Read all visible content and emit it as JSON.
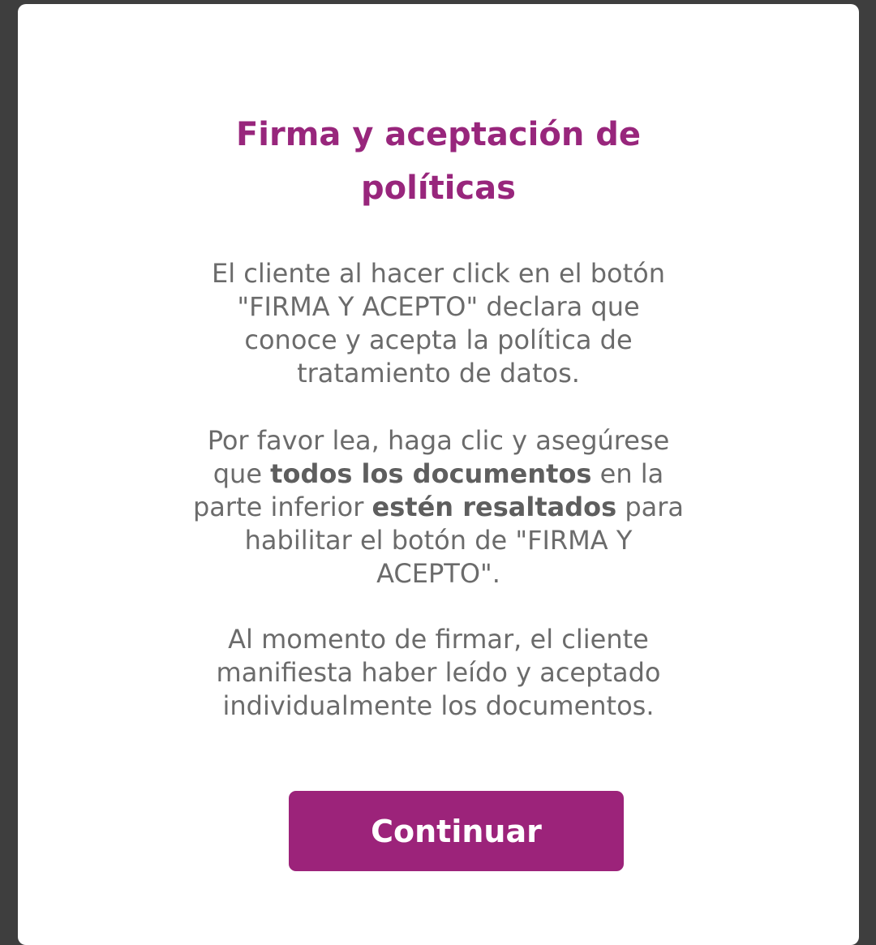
{
  "dialog": {
    "title_lines": [
      "Firma y aceptación de",
      "políticas"
    ],
    "paragraph1_lines": [
      "El cliente al hacer click en el botón",
      "\"FIRMA Y ACEPTO\" declara que",
      "conoce y acepta la política de",
      "tratamiento de datos."
    ],
    "paragraph2": {
      "line1": "Por favor lea, haga clic y asegúrese",
      "line2_pre": "que ",
      "line2_bold": "todos los documentos",
      "line2_post": " en la",
      "line3_pre": "parte inferior ",
      "line3_bold": "estén resaltados",
      "line3_post": " para",
      "line4": "habilitar el botón de \"FIRMA Y",
      "line5": "ACEPTO\"."
    },
    "paragraph3_lines": [
      "Al momento de firmar, el cliente",
      "manifiesta haber leído y aceptado",
      "individualmente los documentos."
    ],
    "continue_label": "Continuar"
  },
  "colors": {
    "accent": "#9c237a",
    "title": "#98267c",
    "body_text": "#6b6b6b",
    "backdrop": "#3e3e3e"
  }
}
